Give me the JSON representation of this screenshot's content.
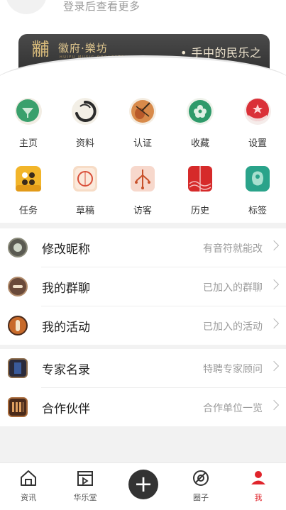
{
  "header": {
    "login_hint": "登录后查看更多"
  },
  "banner": {
    "logo_glyph": "黼",
    "brand": "徽府·樂坊",
    "brand_sub": "HUIFU MUSIC ORCHESTRA",
    "slogan": "• 手中的民乐之家"
  },
  "grid": [
    {
      "label": "主页",
      "icon": "home-icon",
      "color": "#3a9a6a"
    },
    {
      "label": "资料",
      "icon": "profile-icon",
      "color": "#2b2b2b"
    },
    {
      "label": "认证",
      "icon": "certification-icon",
      "color": "#c86a3a"
    },
    {
      "label": "收藏",
      "icon": "favorite-icon",
      "color": "#2e9a6a"
    },
    {
      "label": "设置",
      "icon": "settings-icon",
      "color": "#d9303a"
    },
    {
      "label": "任务",
      "icon": "task-icon",
      "color": "#f0b82a"
    },
    {
      "label": "草稿",
      "icon": "draft-icon",
      "color": "#d98a5a"
    },
    {
      "label": "访客",
      "icon": "visitor-icon",
      "color": "#c8502a"
    },
    {
      "label": "历史",
      "icon": "history-icon",
      "color": "#d42a2a"
    },
    {
      "label": "标签",
      "icon": "tag-icon",
      "color": "#2aa38a"
    }
  ],
  "menu": [
    {
      "title": "修改昵称",
      "value": "有音符就能改",
      "icon": "speaker-icon"
    },
    {
      "title": "我的群聊",
      "value": "已加入的群聊",
      "icon": "drum-icon"
    },
    {
      "title": "我的活动",
      "value": "已加入的活动",
      "icon": "pipa-icon"
    }
  ],
  "menu2": [
    {
      "title": "专家名录",
      "value": "特聘专家顾问",
      "icon": "book-icon"
    },
    {
      "title": "合作伙伴",
      "value": "合作单位一览",
      "icon": "partner-icon"
    }
  ],
  "tabbar": [
    {
      "label": "资讯",
      "icon": "news-icon"
    },
    {
      "label": "华乐堂",
      "icon": "hall-icon"
    },
    {
      "label": "",
      "icon": "plus-icon"
    },
    {
      "label": "圈子",
      "icon": "circle-icon"
    },
    {
      "label": "我",
      "icon": "me-icon"
    }
  ],
  "colors": {
    "accent": "#e0242b",
    "banner_bg": "#3b3b3b",
    "banner_gold": "#e1c88f"
  }
}
